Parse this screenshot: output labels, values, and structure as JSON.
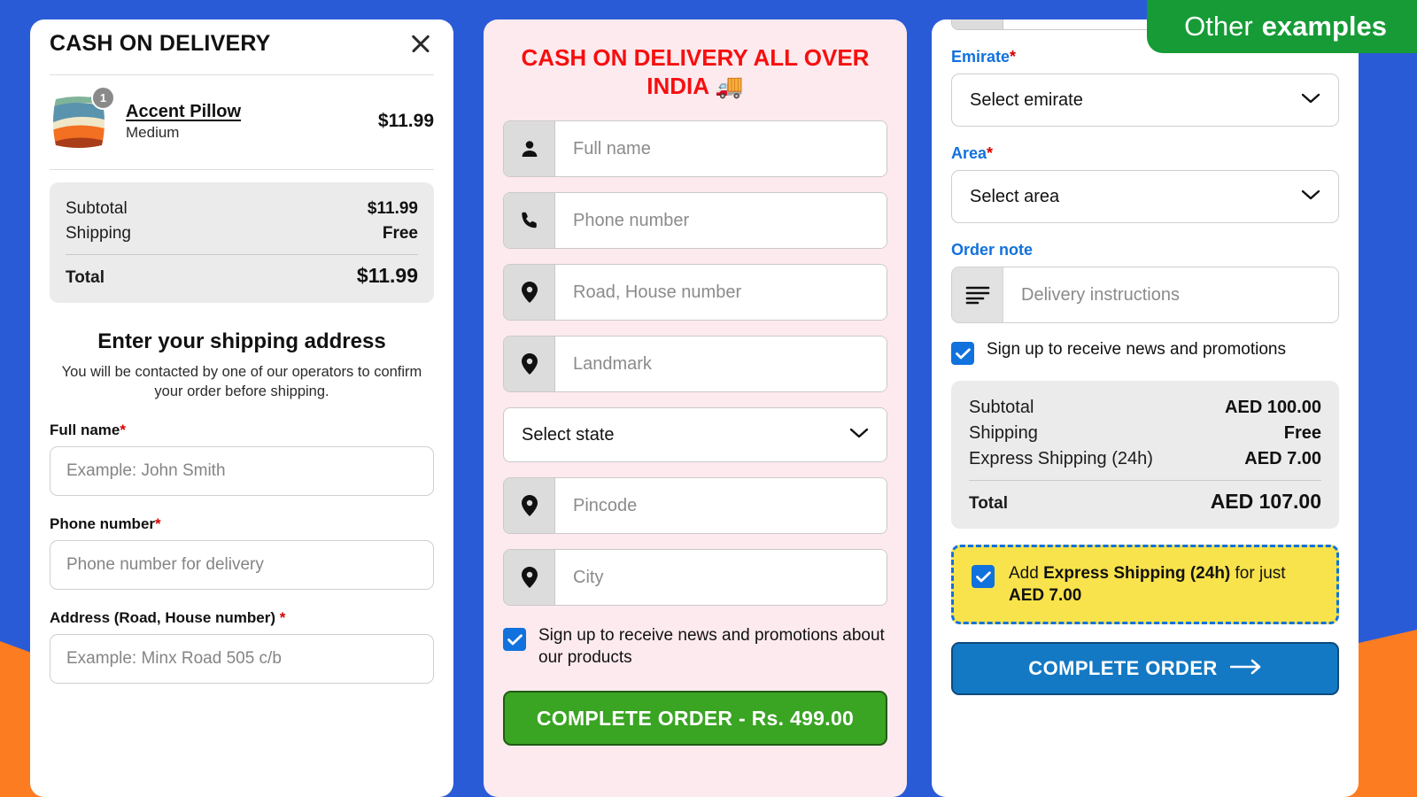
{
  "badge": {
    "text_regular": "Other",
    "text_bold": "examples"
  },
  "panel1": {
    "title": "CASH ON DELIVERY",
    "close_icon": "close-icon",
    "line_item": {
      "qty": "1",
      "name": "Accent Pillow",
      "variant": "Medium",
      "price": "$11.99"
    },
    "totals": {
      "rows": [
        {
          "label": "Subtotal",
          "value": "$11.99"
        },
        {
          "label": "Shipping",
          "value": "Free"
        }
      ],
      "total_label": "Total",
      "total_value": "$11.99"
    },
    "section_title": "Enter your shipping address",
    "section_sub": "You will be contacted by one of our operators to confirm your order before shipping.",
    "fields": [
      {
        "label": "Full name",
        "required": "*",
        "placeholder": "Example: John Smith"
      },
      {
        "label": "Phone number",
        "required": "*",
        "placeholder": "Phone number for delivery"
      },
      {
        "label": "Address (Road, House number)",
        "required": "*",
        "placeholder": "Example: Minx Road 505 c/b"
      }
    ]
  },
  "panel2": {
    "title": "CASH ON DELIVERY ALL OVER INDIA 🚚",
    "fields": [
      {
        "icon": "person-icon",
        "placeholder": "Full name"
      },
      {
        "icon": "phone-icon",
        "placeholder": "Phone number"
      },
      {
        "icon": "location-pin-icon",
        "placeholder": "Road, House number"
      },
      {
        "icon": "location-pin-icon",
        "placeholder": "Landmark"
      }
    ],
    "state_select": "Select state",
    "fields2": [
      {
        "icon": "location-pin-icon",
        "placeholder": "Pincode"
      },
      {
        "icon": "location-pin-icon",
        "placeholder": "City"
      }
    ],
    "newsletter_label": "Sign up to receive news and promotions about our products",
    "newsletter_checked": true,
    "submit_label": "COMPLETE ORDER - Rs. 499.00"
  },
  "panel3": {
    "emirate_label": "Emirate",
    "emirate_required": "*",
    "emirate_value": "Select emirate",
    "area_label": "Area",
    "area_required": "*",
    "area_value": "Select area",
    "order_note_label": "Order note",
    "order_note_placeholder": "Delivery instructions",
    "order_note_icon": "lines-icon",
    "newsletter_label": "Sign up to receive news and promotions",
    "newsletter_checked": true,
    "totals": {
      "rows": [
        {
          "label": "Subtotal",
          "value": "AED 100.00"
        },
        {
          "label": "Shipping",
          "value": "Free"
        },
        {
          "label": "Express Shipping (24h)",
          "value": "AED 7.00"
        }
      ],
      "total_label": "Total",
      "total_value": "AED 107.00"
    },
    "upsell": {
      "prefix": "Add ",
      "bold1": "Express Shipping (24h)",
      "middle": " for just ",
      "bold2": "AED 7.00",
      "checked": true
    },
    "submit_label": "COMPLETE ORDER"
  },
  "colors": {
    "background_blue": "#2a5bd7",
    "accent_orange": "#fc7c21",
    "panel2_bg": "#fdeaee",
    "panel2_title_red": "#f60f0f",
    "label_blue": "#1171dd",
    "green_button": "#3aa423",
    "blue_button": "#1479c4",
    "upsell_yellow": "#f8e34c",
    "badge_green": "#169b36",
    "required_red": "#d40000"
  }
}
